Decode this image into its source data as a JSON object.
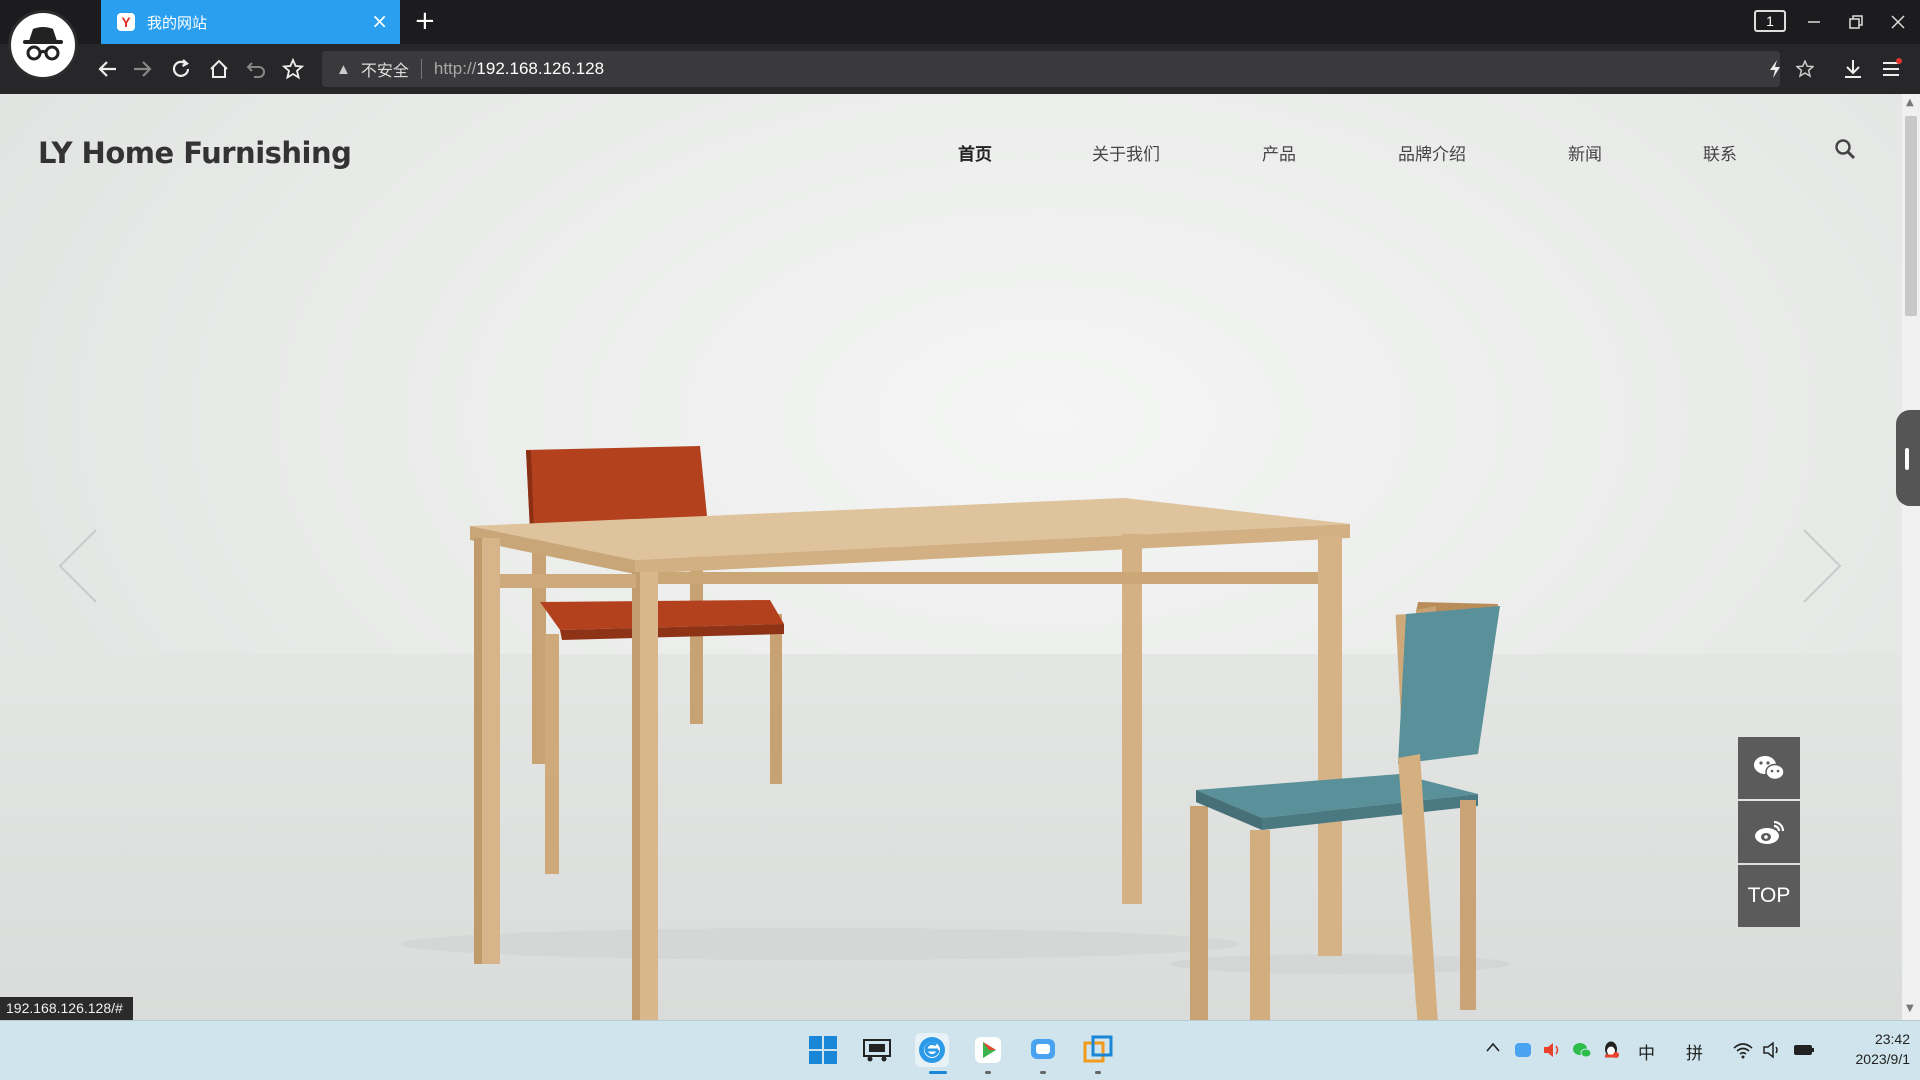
{
  "browser": {
    "tab_title": "我的网站",
    "tab_favicon": "Y",
    "tab_close": "×",
    "new_tab": "+",
    "tab_count": "1",
    "security_label": "不安全",
    "url_scheme": "http://",
    "url_host": "192.168.126.128",
    "status_link": "192.168.126.128/#",
    "accent_color": "#2a9ff0"
  },
  "site": {
    "logo": "LY Home Furnishing",
    "nav": [
      {
        "label": "首页",
        "active": true
      },
      {
        "label": "关于我们"
      },
      {
        "label": "产品"
      },
      {
        "label": "品牌介绍"
      },
      {
        "label": "新闻"
      },
      {
        "label": "联系"
      }
    ],
    "side_buttons": {
      "wechat_icon": "wechat-icon",
      "weibo_icon": "weibo-icon",
      "top_label": "TOP"
    },
    "banner_colors": {
      "orange_chair": "#b4411e",
      "teal_chair": "#5a9099",
      "wood": "#d9b98f"
    }
  },
  "taskbar": {
    "ime_lang": "中",
    "ime_mode": "拼",
    "time": "23:42",
    "date": "2023/9/1"
  }
}
